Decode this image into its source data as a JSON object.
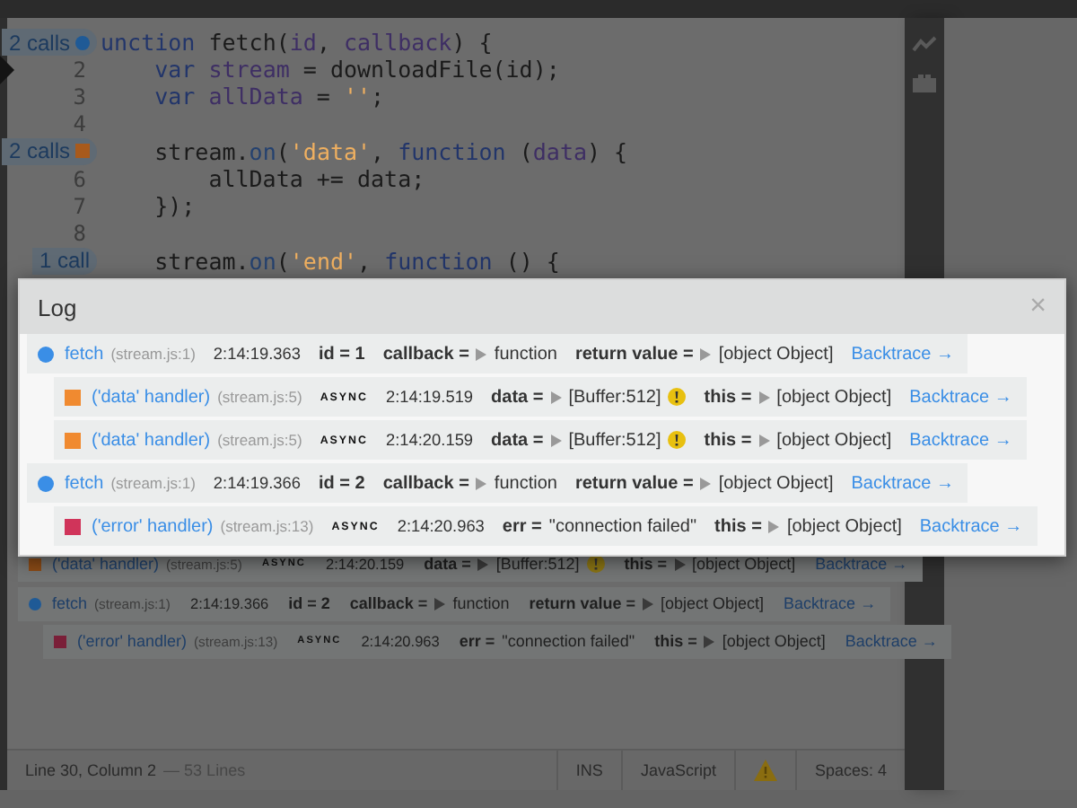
{
  "editor": {
    "lines": [
      {
        "current": false,
        "badge": {
          "text": "2 calls",
          "kind": "circle",
          "color": "#1f5a96"
        },
        "tokens": [
          {
            "text": "unction",
            "kind": "keyword"
          },
          {
            "text": " fetch(",
            "kind": "plain"
          },
          {
            "text": "id",
            "kind": "variable"
          },
          {
            "text": ", ",
            "kind": "plain"
          },
          {
            "text": "callback",
            "kind": "variable"
          },
          {
            "text": ") {",
            "kind": "plain"
          }
        ]
      },
      {
        "number": "2",
        "current": true,
        "tokens": [
          {
            "text": "    var",
            "kind": "keyword"
          },
          {
            "text": " stream",
            "kind": "variable"
          },
          {
            "text": " = downloadFile(id);",
            "kind": "plain"
          }
        ]
      },
      {
        "number": "3",
        "current": false,
        "tokens": [
          {
            "text": "    var",
            "kind": "keyword"
          },
          {
            "text": " allData",
            "kind": "variable"
          },
          {
            "text": " = ",
            "kind": "plain"
          },
          {
            "text": "''",
            "kind": "string"
          },
          {
            "text": ";",
            "kind": "plain"
          }
        ]
      },
      {
        "number": "4",
        "current": false
      },
      {
        "current": false,
        "badge": {
          "text": "2 calls",
          "kind": "square",
          "color": "#a85a1c"
        },
        "tokens": [
          {
            "text": "    stream.",
            "kind": "plain"
          },
          {
            "text": "on",
            "kind": "property"
          },
          {
            "text": "(",
            "kind": "plain"
          },
          {
            "text": "'data'",
            "kind": "string"
          },
          {
            "text": ", ",
            "kind": "plain"
          },
          {
            "text": "function",
            "kind": "keyword"
          },
          {
            "text": " (",
            "kind": "plain"
          },
          {
            "text": "data",
            "kind": "variable"
          },
          {
            "text": ") {",
            "kind": "plain"
          }
        ]
      },
      {
        "number": "6",
        "current": false,
        "tokens": [
          {
            "text": "        allData += data;",
            "kind": "plain"
          }
        ]
      },
      {
        "number": "7",
        "current": false,
        "tokens": [
          {
            "text": "    });",
            "kind": "plain"
          }
        ]
      },
      {
        "number": "8",
        "current": false
      },
      {
        "current": false,
        "badge": {
          "text": "1 call",
          "kind": "plain"
        },
        "tokens": [
          {
            "text": "    stream.",
            "kind": "plain"
          },
          {
            "text": "on",
            "kind": "property"
          },
          {
            "text": "(",
            "kind": "plain"
          },
          {
            "text": "'end'",
            "kind": "string"
          },
          {
            "text": ", ",
            "kind": "plain"
          },
          {
            "text": "function",
            "kind": "keyword"
          },
          {
            "text": " () {",
            "kind": "plain"
          }
        ]
      }
    ],
    "inline_log": {
      "entries": [
        {
          "kind": "square",
          "color": "#8a4a16",
          "name": "('data' handler)",
          "location": "(stream.js:5)",
          "tag": "ASYNC",
          "time": "2:14:20.159",
          "params": [
            {
              "label": "data =",
              "value": "[Buffer:512]",
              "expandable": true,
              "warning": true
            },
            {
              "label": "this =",
              "value": "[object Object]",
              "expandable": true,
              "warning": false
            }
          ],
          "backtrace": "Backtrace →"
        },
        {
          "kind": "circle",
          "color": "#1f5a96",
          "name": "fetch",
          "location": "(stream.js:1)",
          "time": "2:14:19.366",
          "params": [
            {
              "label": "id = 2",
              "expandable": false,
              "warning": false
            },
            {
              "label": "callback =",
              "value": "function",
              "expandable": true,
              "warning": false
            },
            {
              "label": "return value =",
              "value": "[object Object]",
              "expandable": true,
              "warning": false
            }
          ],
          "backtrace": "Backtrace →",
          "children": [
            {
              "kind": "square",
              "color": "#7a1f38",
              "name": "('error' handler)",
              "location": "(stream.js:13)",
              "tag": "ASYNC",
              "time": "2:14:20.963",
              "params": [
                {
                  "label": "err =",
                  "value": "\"connection failed\"",
                  "expandable": false,
                  "warning": false
                },
                {
                  "label": "this =",
                  "value": "[object Object]",
                  "expandable": true,
                  "warning": false
                }
              ],
              "backtrace": "Backtrace →"
            }
          ]
        }
      ]
    }
  },
  "log_popup": {
    "title": "Log",
    "close": "×",
    "entries": [
      {
        "kind": "circle",
        "color": "#3a8ee6",
        "name": "fetch",
        "location": "(stream.js:1)",
        "time": "2:14:19.363",
        "params": [
          {
            "label": "id = 1",
            "expandable": false,
            "warning": false
          },
          {
            "label": "callback =",
            "value": "function",
            "expandable": true,
            "warning": false
          },
          {
            "label": "return value =",
            "value": "[object Object]",
            "expandable": true,
            "warning": false
          }
        ],
        "backtrace": "Backtrace →",
        "children": [
          {
            "kind": "square",
            "color": "#f08a30",
            "name": "('data' handler)",
            "location": "(stream.js:5)",
            "tag": "ASYNC",
            "time": "2:14:19.519",
            "params": [
              {
                "label": "data =",
                "value": "[Buffer:512]",
                "expandable": true,
                "warning": true
              },
              {
                "label": "this =",
                "value": "[object Object]",
                "expandable": true,
                "warning": false
              }
            ],
            "backtrace": "Backtrace →"
          },
          {
            "kind": "square",
            "color": "#f08a30",
            "name": "('data' handler)",
            "location": "(stream.js:5)",
            "tag": "ASYNC",
            "time": "2:14:20.159",
            "params": [
              {
                "label": "data =",
                "value": "[Buffer:512]",
                "expandable": true,
                "warning": true
              },
              {
                "label": "this =",
                "value": "[object Object]",
                "expandable": true,
                "warning": false
              }
            ],
            "backtrace": "Backtrace →"
          }
        ]
      },
      {
        "kind": "circle",
        "color": "#3a8ee6",
        "name": "fetch",
        "location": "(stream.js:1)",
        "time": "2:14:19.366",
        "params": [
          {
            "label": "id = 2",
            "expandable": false,
            "warning": false
          },
          {
            "label": "callback =",
            "value": "function",
            "expandable": true,
            "warning": false
          },
          {
            "label": "return value =",
            "value": "[object Object]",
            "expandable": true,
            "warning": false
          }
        ],
        "backtrace": "Backtrace →",
        "children": [
          {
            "kind": "square",
            "color": "#d0345a",
            "name": "('error' handler)",
            "location": "(stream.js:13)",
            "tag": "ASYNC",
            "time": "2:14:20.963",
            "params": [
              {
                "label": "err =",
                "value": "\"connection failed\"",
                "expandable": false,
                "warning": false
              },
              {
                "label": "this =",
                "value": "[object Object]",
                "expandable": true,
                "warning": false
              }
            ],
            "backtrace": "Backtrace →"
          }
        ]
      }
    ]
  },
  "status_bar": {
    "position": "Line 30, Column 2",
    "line_count": "— 53 Lines",
    "mode": "INS",
    "language": "JavaScript",
    "warning": true,
    "indent": "Spaces: 4"
  }
}
